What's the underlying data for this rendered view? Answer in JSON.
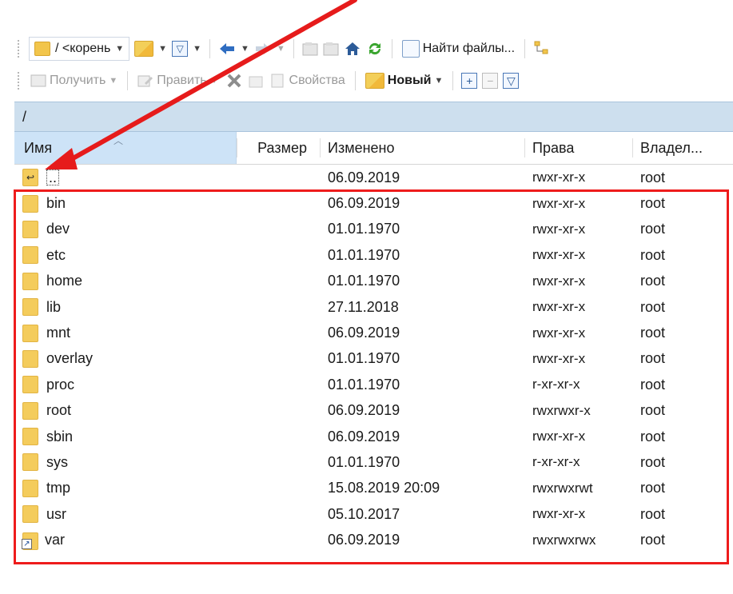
{
  "toolbar_top": {
    "path_label": "/ <корень",
    "find_files_label": "Найти файлы...",
    "icons": [
      "folder-icon",
      "chevron-down-icon",
      "open-folder-icon",
      "chevron-down-icon",
      "filter-icon",
      "chevron-down-icon",
      "back-arrow-icon",
      "chevron-down-icon",
      "forward-arrow-icon",
      "chevron-down-icon",
      "parent-folder-icon",
      "root-folder-icon",
      "home-icon",
      "refresh-icon",
      "search-icon",
      "tree-icon"
    ]
  },
  "toolbar_actions": {
    "get_label": "Получить",
    "edit_label": "Править",
    "properties_label": "Свойства",
    "new_label": "Новый"
  },
  "path_bar": {
    "path": "/"
  },
  "columns": {
    "name": "Имя",
    "size": "Размер",
    "modified": "Изменено",
    "permissions": "Права",
    "owner": "Владел..."
  },
  "rows": [
    {
      "name": "..",
      "modified": "06.09.2019",
      "permissions": "rwxr-xr-x",
      "owner": "root",
      "icon": "parent-directory-icon"
    },
    {
      "name": "bin",
      "modified": "06.09.2019",
      "permissions": "rwxr-xr-x",
      "owner": "root",
      "icon": "folder-icon"
    },
    {
      "name": "dev",
      "modified": "01.01.1970",
      "permissions": "rwxr-xr-x",
      "owner": "root",
      "icon": "folder-icon"
    },
    {
      "name": "etc",
      "modified": "01.01.1970",
      "permissions": "rwxr-xr-x",
      "owner": "root",
      "icon": "folder-icon"
    },
    {
      "name": "home",
      "modified": "01.01.1970",
      "permissions": "rwxr-xr-x",
      "owner": "root",
      "icon": "folder-icon"
    },
    {
      "name": "lib",
      "modified": "27.11.2018",
      "permissions": "rwxr-xr-x",
      "owner": "root",
      "icon": "folder-icon"
    },
    {
      "name": "mnt",
      "modified": "06.09.2019",
      "permissions": "rwxr-xr-x",
      "owner": "root",
      "icon": "folder-icon"
    },
    {
      "name": "overlay",
      "modified": "01.01.1970",
      "permissions": "rwxr-xr-x",
      "owner": "root",
      "icon": "folder-icon"
    },
    {
      "name": "proc",
      "modified": "01.01.1970",
      "permissions": "r-xr-xr-x",
      "owner": "root",
      "icon": "folder-icon"
    },
    {
      "name": "root",
      "modified": "06.09.2019",
      "permissions": "rwxrwxr-x",
      "owner": "root",
      "icon": "folder-icon"
    },
    {
      "name": "sbin",
      "modified": "06.09.2019",
      "permissions": "rwxr-xr-x",
      "owner": "root",
      "icon": "folder-icon"
    },
    {
      "name": "sys",
      "modified": "01.01.1970",
      "permissions": "r-xr-xr-x",
      "owner": "root",
      "icon": "folder-icon"
    },
    {
      "name": "tmp",
      "modified": "15.08.2019 20:09",
      "permissions": "rwxrwxrwt",
      "owner": "root",
      "icon": "folder-icon"
    },
    {
      "name": "usr",
      "modified": "05.10.2017",
      "permissions": "rwxr-xr-x",
      "owner": "root",
      "icon": "folder-icon"
    },
    {
      "name": "var",
      "modified": "06.09.2019",
      "permissions": "rwxrwxrwx",
      "owner": "root",
      "icon": "folder-link-icon"
    }
  ],
  "annotations": {
    "arrow_color": "#e61b1b",
    "highlight_color": "#ee1c1c"
  }
}
